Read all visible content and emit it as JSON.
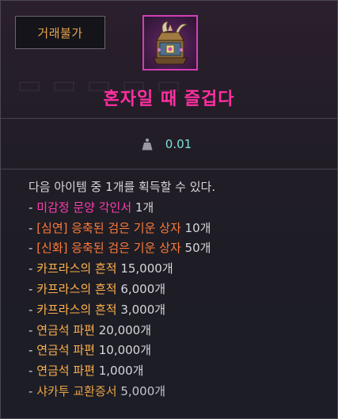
{
  "badge": {
    "label": "거래불가"
  },
  "item": {
    "icon": "ornate-chest-icon",
    "name": "혼자일 때 즐겁다"
  },
  "weight": {
    "icon": "weight-icon",
    "value": "0.01"
  },
  "description": "다음 아이템 중 1개를 획득할 수 있다.",
  "rewards": [
    {
      "prefix": "- ",
      "name": "미감정 문양 각인서",
      "qty": " 1개",
      "color": "#ff3db0"
    },
    {
      "prefix": "- ",
      "name": "[심연] 응축된 검은 기운 상자",
      "qty": " 10개",
      "color": "#ff7a3a"
    },
    {
      "prefix": "- ",
      "name": "[신화] 응축된 검은 기운 상자",
      "qty": " 50개",
      "color": "#ff7a3a"
    },
    {
      "prefix": "- ",
      "name": "카프라스의 흔적",
      "qty": " 15,000개",
      "color": "#ffb14a"
    },
    {
      "prefix": "- ",
      "name": "카프라스의 흔적",
      "qty": " 6,000개",
      "color": "#ffb14a"
    },
    {
      "prefix": "- ",
      "name": "카프라스의 흔적",
      "qty": " 3,000개",
      "color": "#ffb14a"
    },
    {
      "prefix": "- ",
      "name": "연금석 파편",
      "qty": " 20,000개",
      "color": "#ffb14a"
    },
    {
      "prefix": "- ",
      "name": "연금석 파편",
      "qty": " 10,000개",
      "color": "#ffb14a"
    },
    {
      "prefix": "- ",
      "name": "연금석 파편",
      "qty": " 1,000개",
      "color": "#ffb14a"
    },
    {
      "prefix": "- ",
      "name": "샤카투 교환증서",
      "qty": " 5,000개",
      "color": "#ffb14a"
    }
  ],
  "colors": {
    "title": "#ff2fa0",
    "badge_text": "#e6a54c",
    "weight_value": "#7fe0dc",
    "icon_border": "#d23fb5"
  }
}
